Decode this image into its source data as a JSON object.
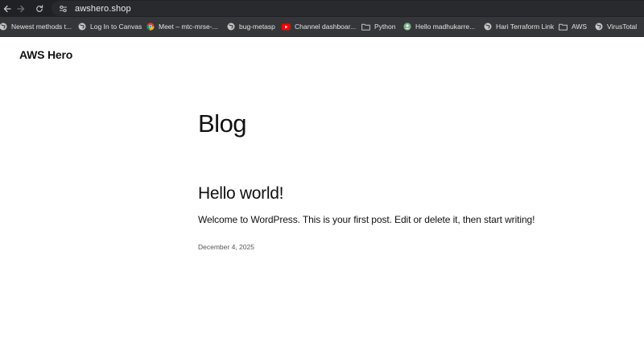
{
  "browser": {
    "url": "awshero.shop",
    "bookmarks": [
      {
        "label": "Newest methods t...",
        "icon": "globe-icon"
      },
      {
        "label": "Log In to Canvas",
        "icon": "globe-icon"
      },
      {
        "label": "Meet – mtc-mrse-...",
        "icon": "chrome-icon"
      },
      {
        "label": "bug-metasp",
        "icon": "globe-icon"
      },
      {
        "label": "Channel dashboar...",
        "icon": "youtube-icon"
      },
      {
        "label": "Python",
        "icon": "folder-icon"
      },
      {
        "label": "Hello madhukarre...",
        "icon": "avatar-icon"
      },
      {
        "label": "Hari Terraform Link",
        "icon": "globe-icon"
      },
      {
        "label": "AWS",
        "icon": "folder-icon"
      },
      {
        "label": "VirusTotal",
        "icon": "globe-icon"
      }
    ]
  },
  "site": {
    "title": "AWS Hero"
  },
  "page": {
    "heading": "Blog"
  },
  "post": {
    "title": "Hello world!",
    "excerpt": "Welcome to WordPress. This is your first post. Edit or delete it, then start writing!",
    "date": "December 4, 2025"
  },
  "colors": {
    "chrome_dark": "#202124",
    "bookmarks_bar": "#353639",
    "youtube_red": "#ff0000"
  }
}
